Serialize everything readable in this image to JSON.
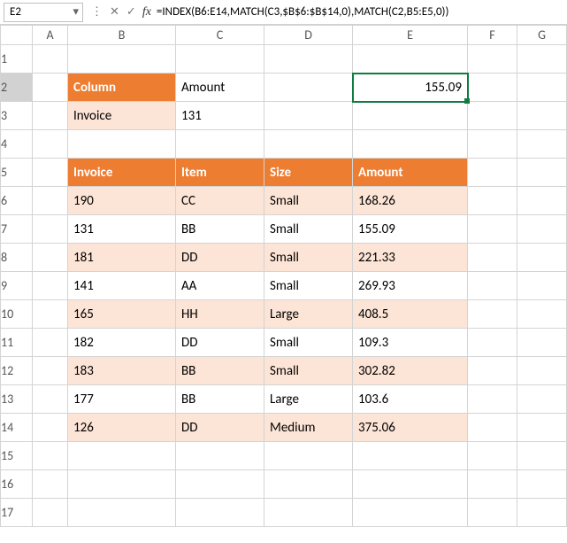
{
  "namebox": {
    "value": "E2"
  },
  "formula_bar": {
    "fx_label": "fx",
    "formula": "=INDEX(B6:E14,MATCH(C3,$B$6:$B$14,0),MATCH(C2,B5:E5,0))"
  },
  "col_headers": [
    "A",
    "B",
    "C",
    "D",
    "E",
    "F",
    "G"
  ],
  "row_headers": [
    "1",
    "2",
    "3",
    "4",
    "5",
    "6",
    "7",
    "8",
    "9",
    "10",
    "11",
    "12",
    "13",
    "14",
    "15",
    "16",
    "17"
  ],
  "lookup": {
    "column_label": "Column",
    "column_value": "Amount",
    "invoice_label": "Invoice",
    "invoice_value": "131",
    "result": "155.09"
  },
  "table": {
    "headers": {
      "invoice": "Invoice",
      "item": "Item",
      "size": "Size",
      "amount": "Amount"
    },
    "rows": [
      {
        "invoice": "190",
        "item": "CC",
        "size": "Small",
        "amount": "168.26"
      },
      {
        "invoice": "131",
        "item": "BB",
        "size": "Small",
        "amount": "155.09"
      },
      {
        "invoice": "181",
        "item": "DD",
        "size": "Small",
        "amount": "221.33"
      },
      {
        "invoice": "141",
        "item": "AA",
        "size": "Small",
        "amount": "269.93"
      },
      {
        "invoice": "165",
        "item": "HH",
        "size": "Large",
        "amount": "408.5"
      },
      {
        "invoice": "182",
        "item": "DD",
        "size": "Small",
        "amount": "109.3"
      },
      {
        "invoice": "183",
        "item": "BB",
        "size": "Small",
        "amount": "302.82"
      },
      {
        "invoice": "177",
        "item": "BB",
        "size": "Large",
        "amount": "103.6"
      },
      {
        "invoice": "126",
        "item": "DD",
        "size": "Medium",
        "amount": "375.06"
      }
    ]
  }
}
